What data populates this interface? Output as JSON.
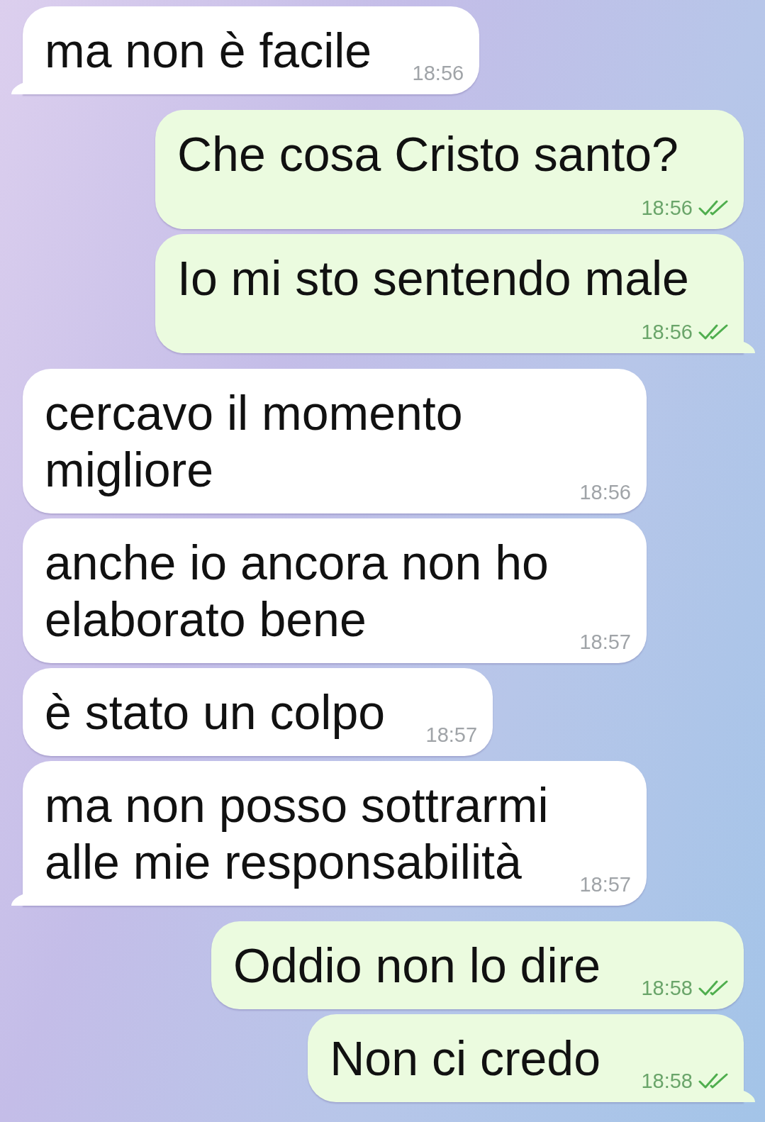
{
  "messages": [
    {
      "kind": "incoming",
      "text": "ma non è facile",
      "time": "18:56",
      "tail": true
    },
    {
      "kind": "outgoing",
      "text": "Che cosa Cristo santo?",
      "time": "18:56",
      "read": true,
      "tail": false
    },
    {
      "kind": "outgoing",
      "text": "Io mi sto sentendo male",
      "time": "18:56",
      "read": true,
      "tail": true
    },
    {
      "kind": "incoming",
      "text": "cercavo il momento migliore",
      "time": "18:56",
      "tail": false
    },
    {
      "kind": "incoming",
      "text": "anche io ancora non ho elaborato bene",
      "time": "18:57",
      "tail": false
    },
    {
      "kind": "incoming",
      "text": "è stato un colpo",
      "time": "18:57",
      "tail": false
    },
    {
      "kind": "incoming",
      "text": "ma non posso sottrarmi alle mie responsabilità",
      "time": "18:57",
      "tail": true
    },
    {
      "kind": "outgoing",
      "text": "Oddio non lo dire",
      "time": "18:58",
      "read": true,
      "tail": false
    },
    {
      "kind": "outgoing",
      "text": "Non ci credo",
      "time": "18:58",
      "read": true,
      "tail": true
    }
  ]
}
